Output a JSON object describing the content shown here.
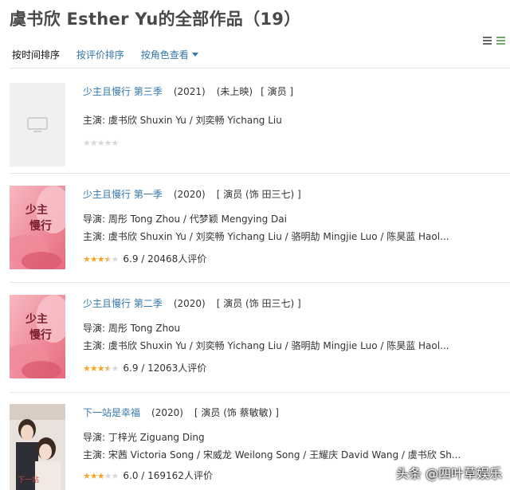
{
  "page": {
    "title": "虞书欣 Esther Yu的全部作品（19）"
  },
  "sort": {
    "by_time": "按时间排序",
    "by_rating": "按评价排序",
    "by_role": "按角色查看"
  },
  "works": [
    {
      "title": "少主且慢行 第三季",
      "year": "(2021)",
      "meta": [
        "(未上映)",
        "[ 演员 ]"
      ],
      "credits": [
        "主演: 虞书欣 Shuxin Yu / 刘奕畅 Yichang Liu"
      ],
      "rating_text": "",
      "stars": 0,
      "poster": "placeholder"
    },
    {
      "title": "少主且慢行 第一季",
      "year": "(2020)",
      "meta": [
        "[ 演员 (饰 田三七) ]"
      ],
      "credits": [
        "导演: 周彤 Tong Zhou / 代梦颖 Mengying Dai",
        "主演: 虞书欣 Shuxin Yu / 刘奕畅 Yichang Liu / 骆明劼 Mingjie Luo / 陈昊蓝 Haol..."
      ],
      "rating_text": "6.9 / 20468人评价",
      "stars": 3.5,
      "poster": "pink"
    },
    {
      "title": "少主且慢行 第二季",
      "year": "(2020)",
      "meta": [
        "[ 演员 (饰 田三七) ]"
      ],
      "credits": [
        "导演: 周彤 Tong Zhou",
        "主演: 虞书欣 Shuxin Yu / 刘奕畅 Yichang Liu / 骆明劼 Mingjie Luo / 陈昊蓝 Haol..."
      ],
      "rating_text": "6.9 / 12063人评价",
      "stars": 3.5,
      "poster": "pink"
    },
    {
      "title": "下一站是幸福",
      "year": "(2020)",
      "meta": [
        "[ 演员 (饰 蔡敏敏) ]"
      ],
      "credits": [
        "导演: 丁梓光 Ziguang Ding",
        "主演: 宋茜 Victoria Song / 宋威龙 Weilong Song / 王耀庆 David Wang / 虞书欣 Sh..."
      ],
      "rating_text": "6.0 / 169162人评价",
      "stars": 3,
      "poster": "couple"
    }
  ],
  "watermark": "头条 @四叶草娱乐",
  "colors": {
    "link": "#3377aa",
    "star": "#f5a623",
    "title": "#494949"
  }
}
